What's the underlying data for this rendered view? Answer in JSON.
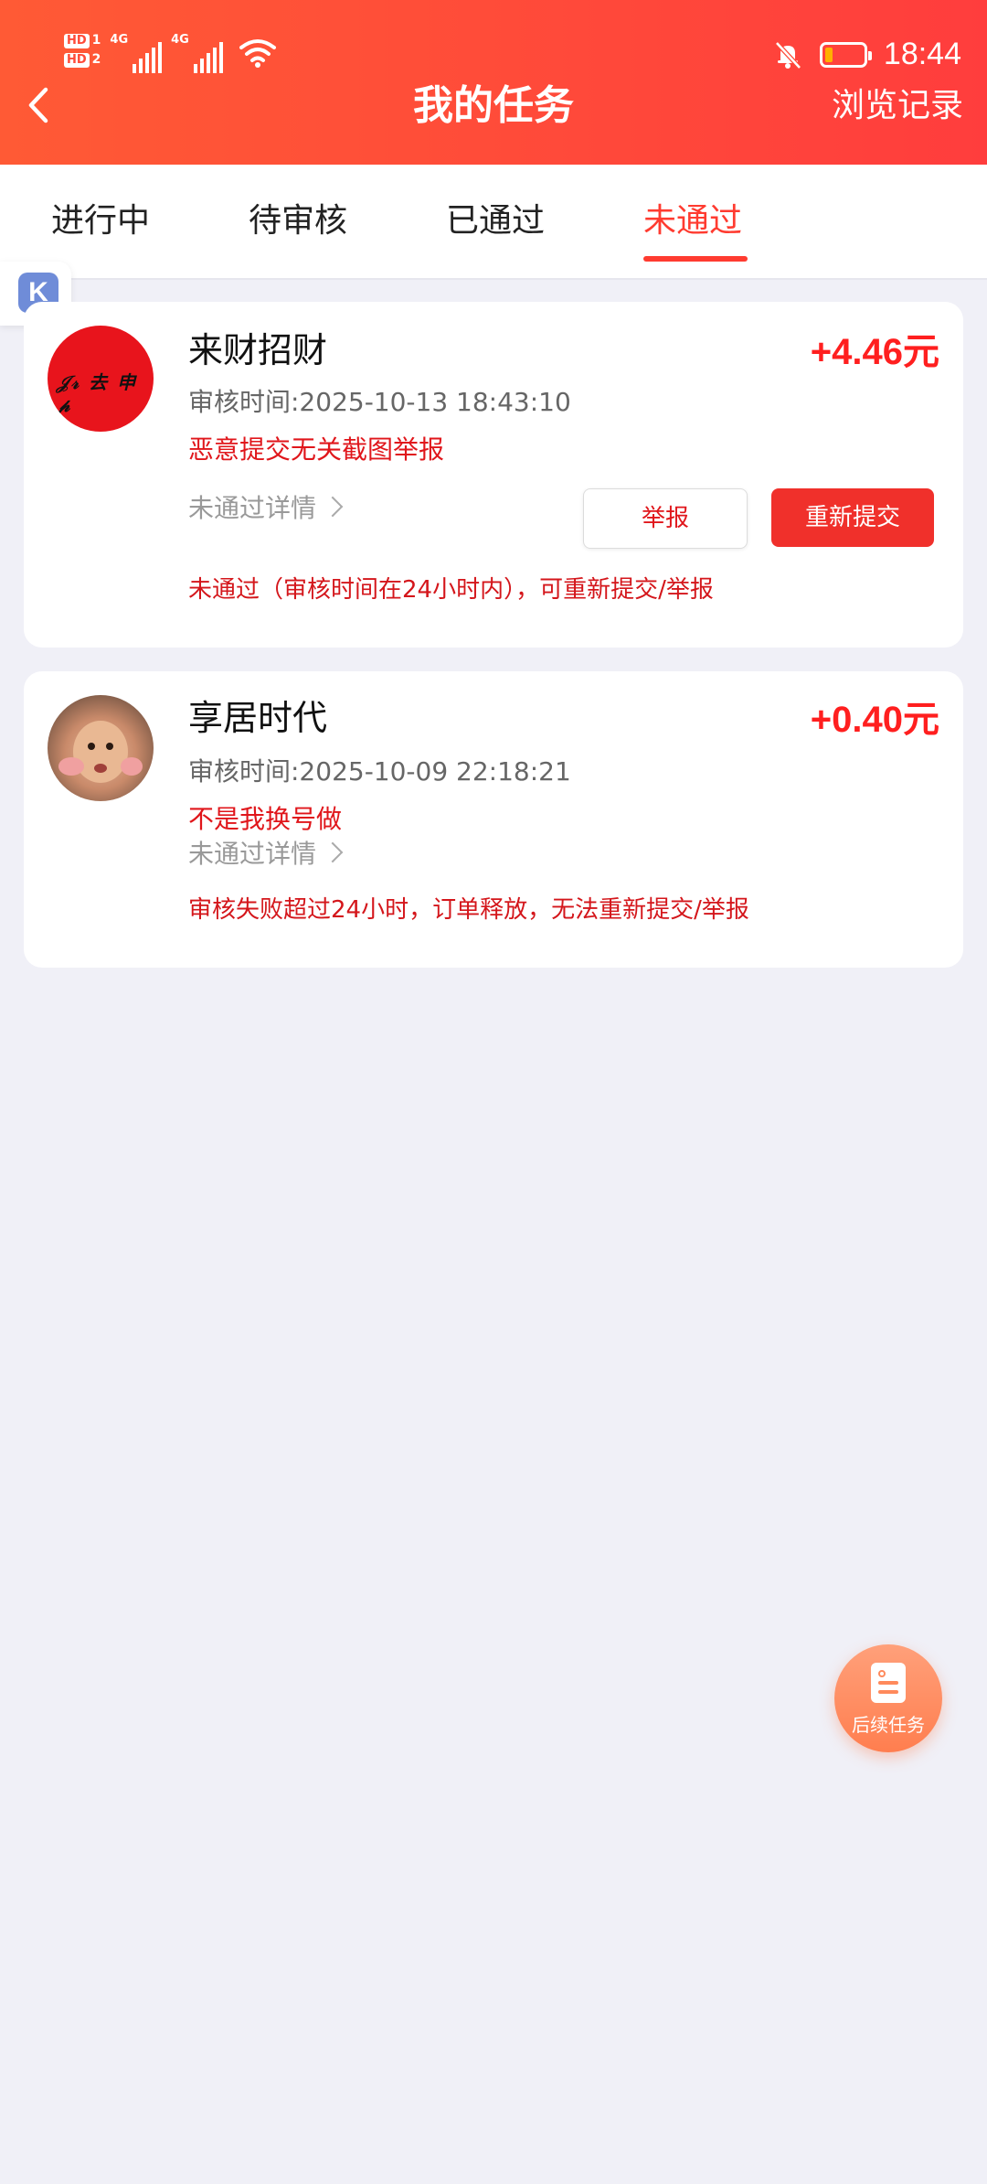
{
  "status_bar": {
    "hd1": "HD",
    "hd1_sub": "1",
    "hd2": "HD",
    "hd2_sub": "2",
    "net1": "4G",
    "net2": "4G",
    "time": "18:44",
    "icons": [
      "signal-icon",
      "wifi-icon",
      "bell-off-icon",
      "battery-icon"
    ],
    "battery_level_fraction": 0.15
  },
  "header": {
    "title": "我的任务",
    "right_link": "浏览记录",
    "back_icon": "chevron-left-icon",
    "colors": {
      "gradient_start": "#ff5a35",
      "gradient_end": "#ff3d3d"
    }
  },
  "tabs": [
    {
      "label": "进行中",
      "active": false
    },
    {
      "label": "待审核",
      "active": false
    },
    {
      "label": "已通过",
      "active": false
    },
    {
      "label": "未通过",
      "active": true
    }
  ],
  "float_tool": {
    "letter": "K",
    "icon": "k-app-icon"
  },
  "tasks": [
    {
      "name": "来财招财",
      "amount": "+4.46元",
      "review_time": "审核时间:2025-10-13 18:43:10",
      "reason": "恶意提交无关截图举报",
      "detail_link": "未通过详情",
      "note": "未通过（审核时间在24小时内），可重新提交/举报",
      "buttons": {
        "report": "举报",
        "resubmit": "重新提交"
      }
    },
    {
      "name": "享居时代",
      "amount": "+0.40元",
      "review_time": "审核时间:2025-10-09 22:18:21",
      "reason": "不是我换号做",
      "detail_link": "未通过详情",
      "note": "审核失败超过24小时，订单释放，无法重新提交/举报"
    }
  ],
  "fab": {
    "label": "后续任务",
    "icon": "document-icon"
  },
  "accent_color": "#ff3b30"
}
